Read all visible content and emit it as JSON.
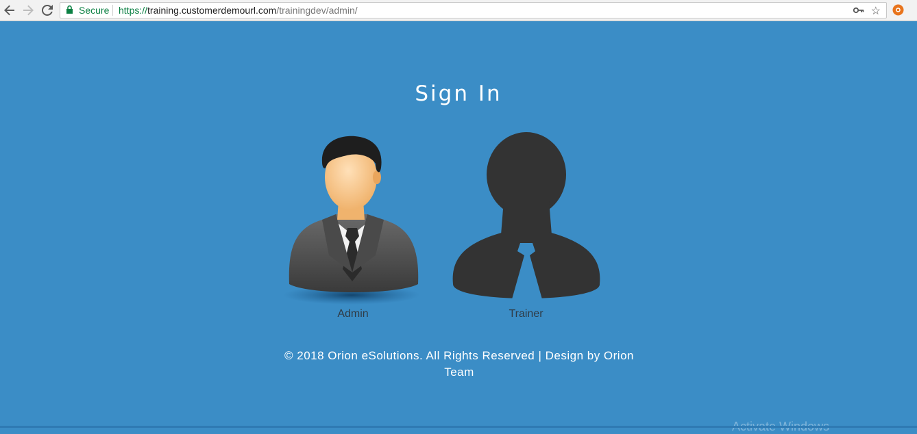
{
  "browser": {
    "secure_label": "Secure",
    "url_scheme": "https://",
    "url_host": "training.customerdemourl.com",
    "url_path": "/trainingdev/admin/",
    "icons": [
      "back-icon",
      "forward-icon",
      "reload-icon",
      "lock-icon",
      "key-icon",
      "star-icon",
      "extension-icon"
    ]
  },
  "page": {
    "title": "Sign In",
    "roles": [
      {
        "label": "Admin",
        "icon": "admin-avatar-icon"
      },
      {
        "label": "Trainer",
        "icon": "trainer-silhouette-icon"
      }
    ],
    "footer": "© 2018 Orion eSolutions. All Rights Reserved | Design by Orion Team",
    "watermark": "Activate Windows"
  },
  "colors": {
    "background": "#3b8dc6",
    "text_light": "#ffffff",
    "label_text": "#2f3b46",
    "secure_green": "#0b8043",
    "silhouette": "#333333"
  }
}
